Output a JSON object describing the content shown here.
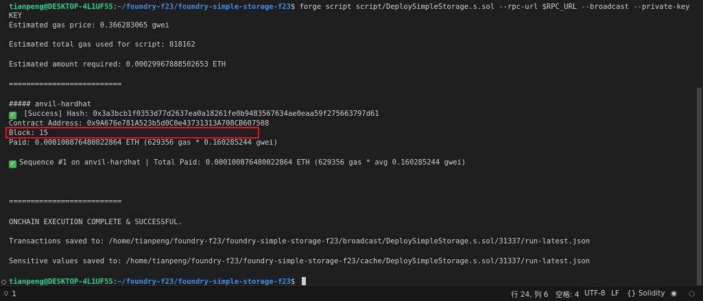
{
  "terminal": {
    "prompt_user": "tianpeng@DESKTOP-4L1UF5S",
    "prompt_sep": ":",
    "prompt_path": "~/foundry-f23/foundry-simple-storage-f23",
    "prompt_dollar": "$ ",
    "command": "forge script script/DeploySimpleStorage.s.sol --rpc-url $RPC_URL --broadcast --private-key $PRIVATE_",
    "command_wrap": "KEY",
    "gas_price": "Estimated gas price: 0.366283065 gwei",
    "total_gas": "Estimated total gas used for script: 818162",
    "amount": "Estimated amount required: 0.00029967888502653 ETH",
    "separator": "==========================",
    "chain_header": "##### anvil-hardhat",
    "success_hash": "[Success] Hash: 0x3a3bcb1f0353d77d2637ea0a18261fe0b9483567634ae0eaa59f275663797d61",
    "contract_address": "Contract Address: 0x9A676e781A523b5d0C0e43731313A708CB607508",
    "block": "Block: 15",
    "paid": "Paid: 0.000100876480022864 ETH (629356 gas * 0.160285244 gwei)",
    "sequence": "Sequence #1 on anvil-hardhat | Total Paid: 0.000100876480022864 ETH (629356 gas * avg 0.160285244 gwei)",
    "separator2": "==========================",
    "complete": "ONCHAIN EXECUTION COMPLETE & SUCCESSFUL.",
    "transactions_saved": "Transactions saved to: /home/tianpeng/foundry-f23/foundry-simple-storage-f23/broadcast/DeploySimpleStorage.s.sol/31337/run-latest.json",
    "sensitive_saved": "Sensitive values saved to: /home/tianpeng/foundry-f23/foundry-simple-storage-f23/cache/DeploySimpleStorage.s.sol/31337/run-latest.json",
    "check_icon": "check-icon",
    "highlight_color": "#e81123"
  },
  "statusbar": {
    "left_count": "1",
    "position": "行 24, 列 6",
    "spaces": "空格: 4",
    "encoding": "UTF-8",
    "eol": "LF",
    "language": "Solidity",
    "language_icon": "{}"
  }
}
